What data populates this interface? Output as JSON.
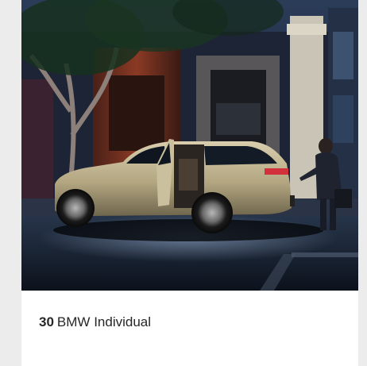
{
  "card": {
    "page_number": "30",
    "title": "BMW Individual"
  },
  "image": {
    "subject": "bmw-x5-suv-night-street",
    "colors": {
      "sky": "#1a2a44",
      "street": "#18212e",
      "car_body": "#b9ad8a",
      "building_warm": "#7a3322",
      "pillar": "#c9c4b6"
    }
  }
}
